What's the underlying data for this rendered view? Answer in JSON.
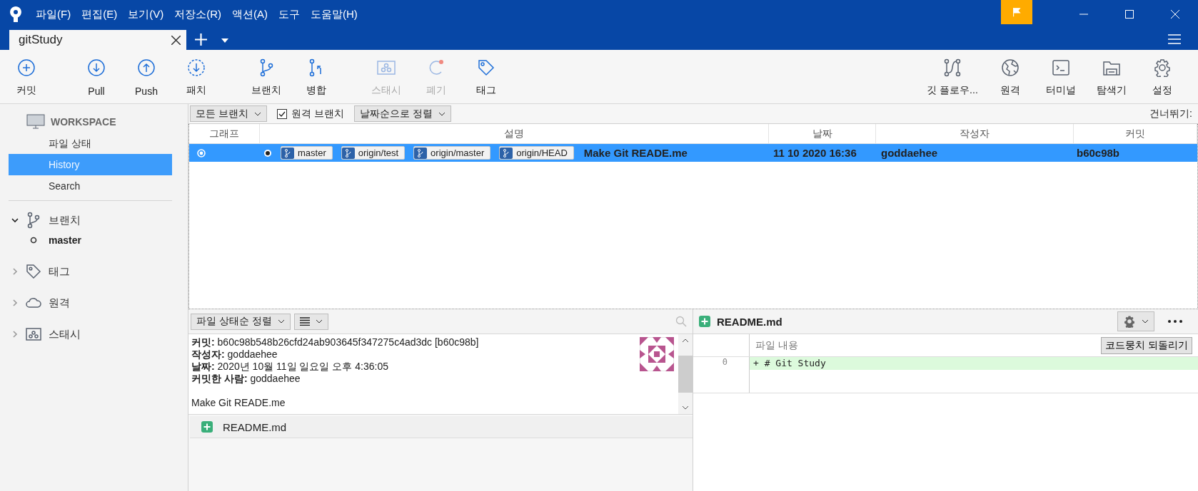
{
  "menu": [
    "파일(F)",
    "편집(E)",
    "보기(V)",
    "저장소(R)",
    "액션(A)",
    "도구",
    "도움말(H)"
  ],
  "tabs": [
    {
      "label": "gitStudy",
      "selected": true
    }
  ],
  "toolbar_left": [
    [
      {
        "kind": "commit",
        "label": "커밋",
        "disabled": false
      }
    ],
    [
      {
        "kind": "pull",
        "label": "Pull",
        "disabled": false
      },
      {
        "kind": "push",
        "label": "Push",
        "disabled": false
      },
      {
        "kind": "fetch",
        "label": "패치",
        "disabled": false
      }
    ],
    [
      {
        "kind": "branch",
        "label": "브랜치",
        "disabled": false
      },
      {
        "kind": "merge",
        "label": "병합",
        "disabled": false
      }
    ],
    [
      {
        "kind": "stash",
        "label": "스태시",
        "disabled": true
      },
      {
        "kind": "discard",
        "label": "폐기",
        "disabled": true
      },
      {
        "kind": "tag",
        "label": "태그",
        "disabled": false
      }
    ]
  ],
  "toolbar_right": [
    {
      "kind": "gitflow",
      "label": "깃 플로우..."
    },
    {
      "kind": "remote",
      "label": "원격"
    },
    {
      "kind": "terminal",
      "label": "터미널"
    },
    {
      "kind": "explorer",
      "label": "탐색기"
    },
    {
      "kind": "settings",
      "label": "설정"
    }
  ],
  "sidebar": {
    "workspace": {
      "title": "WORKSPACE",
      "items": [
        {
          "label": "파일 상태",
          "selected": false
        },
        {
          "label": "History",
          "selected": true
        },
        {
          "label": "Search",
          "selected": false
        }
      ]
    },
    "groups": [
      {
        "kind": "branch",
        "label": "브랜치",
        "expanded": true,
        "children": [
          {
            "label": "master",
            "current": true
          }
        ]
      },
      {
        "kind": "tag",
        "label": "태그",
        "expanded": false
      },
      {
        "kind": "remote",
        "label": "원격",
        "expanded": false
      },
      {
        "kind": "stash",
        "label": "스태시",
        "expanded": false
      }
    ]
  },
  "filters": {
    "branches": "모든 브랜치",
    "remote_branches": {
      "label": "원격 브랜치",
      "checked": true
    },
    "sort": "날짜순으로 정렬",
    "skip": "건너뛰기:"
  },
  "table": {
    "columns": [
      "그래프",
      "설명",
      "날짜",
      "작성자",
      "커밋"
    ],
    "rows": [
      {
        "selected": true,
        "refs": [
          "master",
          "origin/test",
          "origin/master",
          "origin/HEAD"
        ],
        "description": "Make Git READE.me",
        "date": "11 10 2020 16:36",
        "author": "goddaehee",
        "commit": "b60c98b"
      }
    ]
  },
  "details": {
    "sort": "파일 상태순 정렬",
    "lines": [
      "**커밋:** b60c98b548b26cfd24ab903645f347275c4ad3dc [b60c98b]",
      "**작성자:** goddaehee",
      "**날짜:** 2020년 10월 11일 일요일 오후 4:36:05",
      "**커밋한 사람:** goddaehee"
    ],
    "message": "Make Git READE.me",
    "files": [
      {
        "name": "README.md",
        "kind": "added"
      }
    ]
  },
  "diff": {
    "file": "README.md",
    "kind": "added",
    "header": "파일 내용",
    "revert": "코드뭉치 되돌리기",
    "lines": [
      {
        "number": "0",
        "text": "+ # Git Study",
        "kind": "added"
      }
    ]
  }
}
